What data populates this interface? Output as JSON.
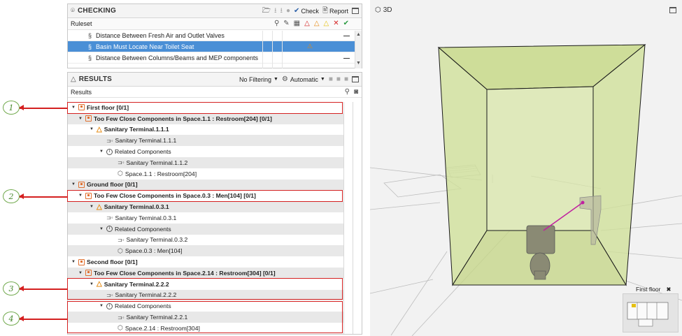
{
  "checking": {
    "title": "CHECKING",
    "check_label": "Check",
    "report_label": "Report",
    "ruleset_label": "Ruleset",
    "rules": [
      {
        "sect": "§",
        "label": "Distance Between Fresh Air and Outlet Valves",
        "mark": "—",
        "selected": false
      },
      {
        "sect": "§",
        "label": "Basin Must Locate Near Toilet Seat",
        "mark": "⚠",
        "selected": true
      },
      {
        "sect": "§",
        "label": "Distance Between Columns/Beams and MEP components",
        "mark": "—",
        "selected": false
      }
    ]
  },
  "results": {
    "title": "RESULTS",
    "filter_label": "No Filtering",
    "mode_label": "Automatic",
    "header_label": "Results",
    "rows": [
      {
        "level": 0,
        "exp": "▼",
        "icon": "space",
        "label": "First floor [0/1]",
        "bold": true
      },
      {
        "level": 1,
        "exp": "▼",
        "icon": "space",
        "label": "Too Few Close Components in Space.1.1 : Restroom[204] [0/1]",
        "bold": true
      },
      {
        "level": 2,
        "exp": "▼",
        "icon": "warn",
        "label": "Sanitary Terminal.1.1.1",
        "bold": true
      },
      {
        "level": 3,
        "exp": "",
        "icon": "comp",
        "label": "Sanitary Terminal.1.1.1",
        "bold": false
      },
      {
        "level": 3,
        "exp": "▼",
        "icon": "info",
        "label": "Related Components",
        "bold": false
      },
      {
        "level": 4,
        "exp": "",
        "icon": "comp",
        "label": "Sanitary Terminal.1.1.2",
        "bold": false
      },
      {
        "level": 4,
        "exp": "",
        "icon": "cube",
        "label": "Space.1.1 : Restroom[204]",
        "bold": false
      },
      {
        "level": 0,
        "exp": "▼",
        "icon": "space",
        "label": "Ground floor [0/1]",
        "bold": true
      },
      {
        "level": 1,
        "exp": "▼",
        "icon": "space",
        "label": "Too Few Close Components in Space.0.3 : Men[104] [0/1]",
        "bold": true
      },
      {
        "level": 2,
        "exp": "▼",
        "icon": "warn",
        "label": "Sanitary Terminal.0.3.1",
        "bold": true
      },
      {
        "level": 3,
        "exp": "",
        "icon": "comp",
        "label": "Sanitary Terminal.0.3.1",
        "bold": false
      },
      {
        "level": 3,
        "exp": "▼",
        "icon": "info",
        "label": "Related Components",
        "bold": false
      },
      {
        "level": 4,
        "exp": "",
        "icon": "comp",
        "label": "Sanitary Terminal.0.3.2",
        "bold": false
      },
      {
        "level": 4,
        "exp": "",
        "icon": "cube",
        "label": "Space.0.3 : Men[104]",
        "bold": false
      },
      {
        "level": 0,
        "exp": "▼",
        "icon": "space",
        "label": "Second floor [0/1]",
        "bold": true
      },
      {
        "level": 1,
        "exp": "▼",
        "icon": "space",
        "label": "Too Few Close Components in Space.2.14 : Restroom[304] [0/1]",
        "bold": true
      },
      {
        "level": 2,
        "exp": "▼",
        "icon": "warn",
        "label": "Sanitary Terminal.2.2.2",
        "bold": true
      },
      {
        "level": 3,
        "exp": "",
        "icon": "comp",
        "label": "Sanitary Terminal.2.2.2",
        "bold": false
      },
      {
        "level": 3,
        "exp": "▼",
        "icon": "info",
        "label": "Related Components",
        "bold": false
      },
      {
        "level": 4,
        "exp": "",
        "icon": "comp",
        "label": "Sanitary Terminal.2.2.1",
        "bold": false
      },
      {
        "level": 4,
        "exp": "",
        "icon": "cube",
        "label": "Space.2.14 : Restroom[304]",
        "bold": false
      }
    ]
  },
  "annotations": [
    "1",
    "2",
    "3",
    "4"
  ],
  "view3d": {
    "title": "3D",
    "floor_label": "First floor"
  },
  "colors": {
    "selected_row": "#4a8fd6",
    "annotation_red": "#d42020",
    "annotation_green": "#6fa84a",
    "room_fill": "#c8d98a"
  }
}
